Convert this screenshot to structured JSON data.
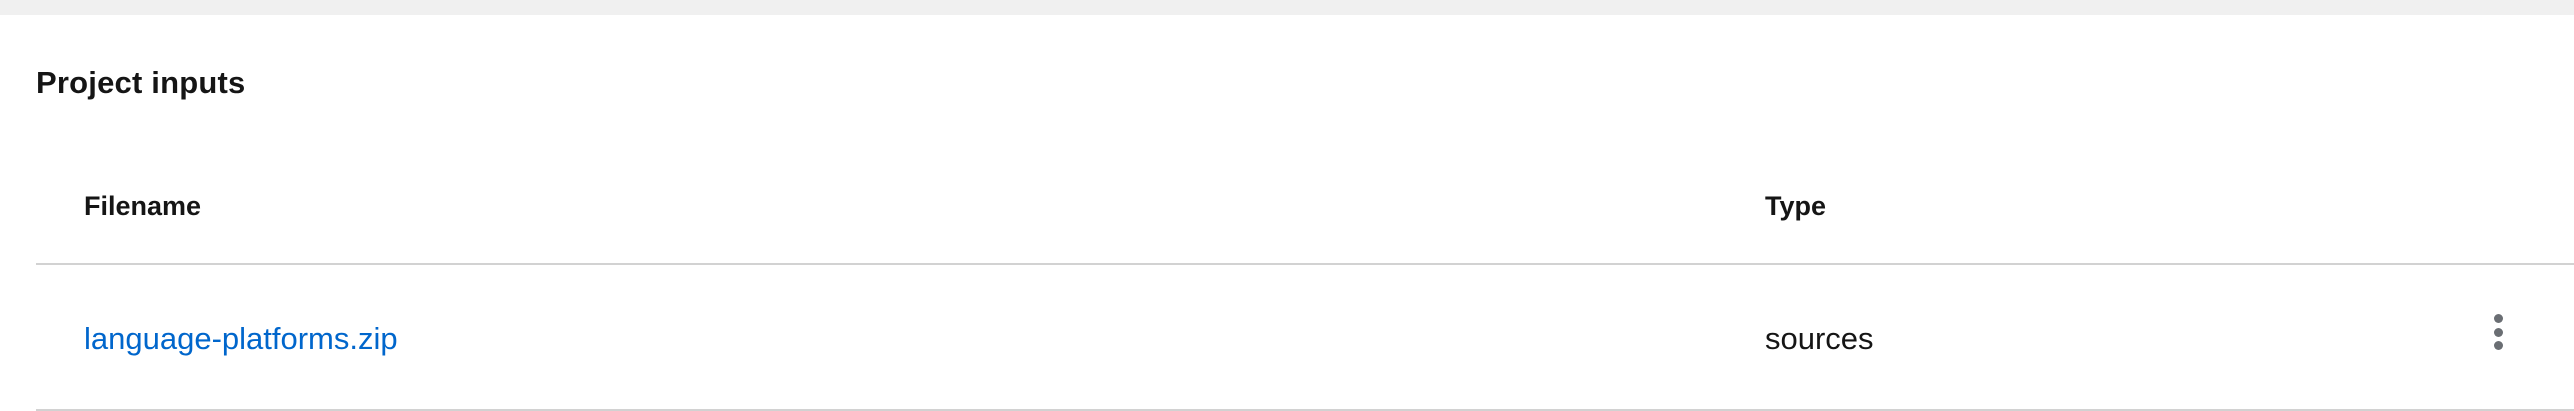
{
  "section": {
    "title": "Project inputs"
  },
  "table": {
    "columns": [
      "Filename",
      "Type"
    ],
    "rows": [
      {
        "filename": "language-platforms.zip",
        "type": "sources",
        "actions_icon": "kebab-menu-icon"
      }
    ]
  },
  "colors": {
    "link": "#0066cc",
    "text": "#151515",
    "divider": "#d2d2d2",
    "top_band": "#f0f0f0",
    "icon": "#6a6e73"
  }
}
